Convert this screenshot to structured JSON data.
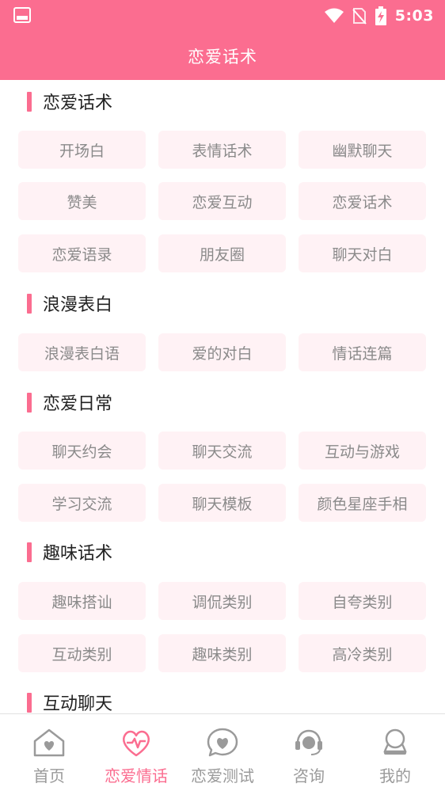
{
  "status_bar": {
    "time": "5:03"
  },
  "header": {
    "title": "恋爱话术"
  },
  "sections": [
    {
      "title": "恋爱话术",
      "items": [
        "开场白",
        "表情话术",
        "幽默聊天",
        "赞美",
        "恋爱互动",
        "恋爱话术",
        "恋爱语录",
        "朋友圈",
        "聊天对白"
      ]
    },
    {
      "title": "浪漫表白",
      "items": [
        "浪漫表白语",
        "爱的对白",
        "情话连篇"
      ]
    },
    {
      "title": "恋爱日常",
      "items": [
        "聊天约会",
        "聊天交流",
        "互动与游戏",
        "学习交流",
        "聊天模板",
        "颜色星座手相"
      ]
    },
    {
      "title": "趣味话术",
      "items": [
        "趣味搭讪",
        "调侃类别",
        "自夸类别",
        "互动类别",
        "趣味类别",
        "高冷类别"
      ]
    },
    {
      "title": "互动聊天",
      "items": []
    }
  ],
  "tabbar": {
    "tabs": [
      {
        "label": "首页",
        "icon": "home-heart-icon",
        "active": false
      },
      {
        "label": "恋爱情话",
        "icon": "heart-pulse-icon",
        "active": true
      },
      {
        "label": "恋爱测试",
        "icon": "heart-chat-icon",
        "active": false
      },
      {
        "label": "咨询",
        "icon": "headset-icon",
        "active": false
      },
      {
        "label": "我的",
        "icon": "user-icon",
        "active": false
      }
    ]
  },
  "colors": {
    "accent": "#fb6d90",
    "chip_bg": "#fff2f5",
    "chip_text": "#8a8a8a"
  }
}
